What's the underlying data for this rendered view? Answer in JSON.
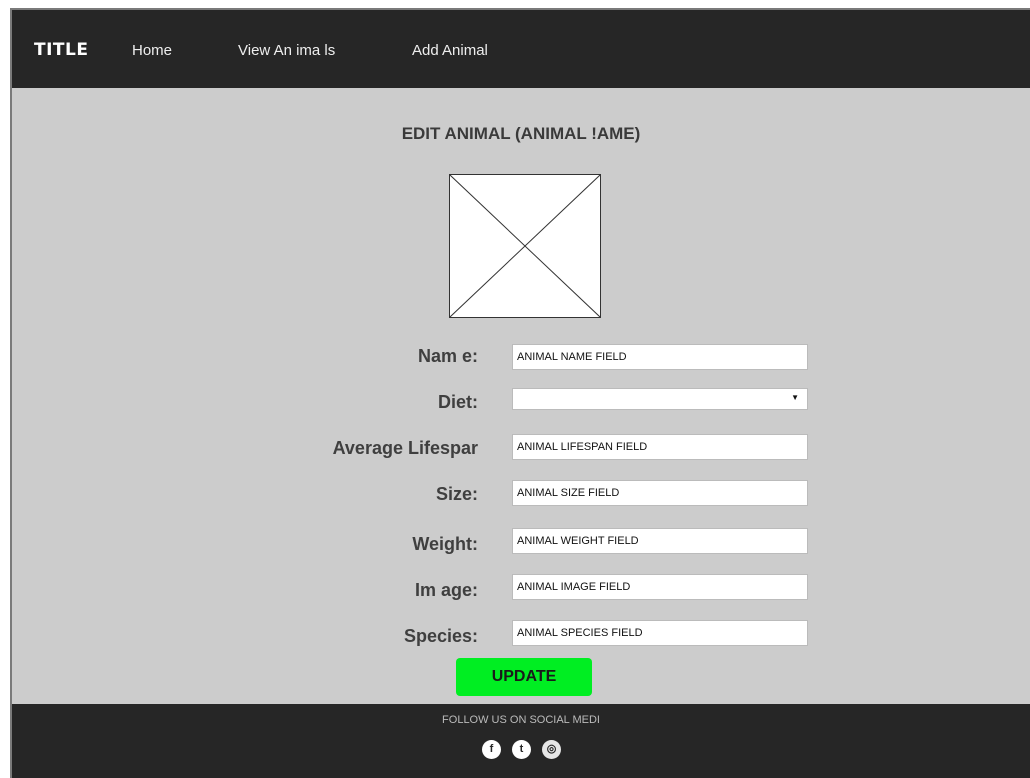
{
  "navbar": {
    "title": "TITLE",
    "links": [
      "Home",
      "View An ima ls",
      "Add Animal"
    ]
  },
  "page": {
    "heading": "EDIT ANIMAL  (ANIMAL !AME)"
  },
  "form": {
    "fields": [
      {
        "label": "Nam e:",
        "value": "ANIMAL NAME FIELD"
      },
      {
        "label": "Diet:",
        "value": ""
      },
      {
        "label": "Average Lifespar",
        "value": "ANIMAL LIFESPAN FIELD"
      },
      {
        "label": "Size:",
        "value": "ANIMAL SIZE FIELD"
      },
      {
        "label": "Weight:",
        "value": "ANIMAL WEIGHT FIELD"
      },
      {
        "label": "Im age:",
        "value": "ANIMAL IMAGE FIELD"
      },
      {
        "label": "Species:",
        "value": "ANIMAL SPECIES FIELD"
      }
    ],
    "submit_label": "UPDATE"
  },
  "footer": {
    "text": "FOLLOW US ON SOCIAL MEDI",
    "icons": [
      "facebook-icon",
      "twitter-icon",
      "instagram-icon"
    ],
    "icon_glyphs": [
      "f",
      "t",
      "◎"
    ]
  },
  "colors": {
    "navbar_bg": "#262626",
    "body_bg": "#cccccc",
    "update_button": "#00ee22"
  }
}
